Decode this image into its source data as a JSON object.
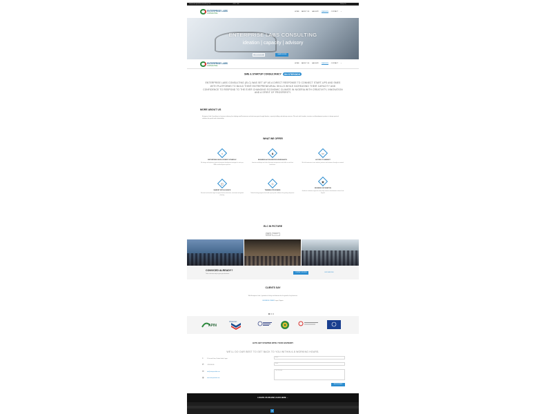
{
  "topbar": {
    "left": "info@enterpriselabsconsulting.com",
    "phone": "+234 · 000",
    "right": "Follow Us"
  },
  "logo": {
    "line1": "ENTERPRISE LABS",
    "line2": "CONSULTING"
  },
  "nav": {
    "items": [
      "HOME",
      "ABOUT US",
      "GALLERY",
      "CAREERS",
      "CONTACT"
    ],
    "active_index": 3,
    "search_icon": "search-icon"
  },
  "hero": {
    "title": "ENTERPRISE LABS CONSULTING",
    "tagline": "ideation | capacity | advisory",
    "btn_primary": "ABOUT US",
    "btn_secondary": "LEARN MORE"
  },
  "intro": {
    "title": "SME & STARTUP CONSULTANCY",
    "pill": "ON STEROIDS",
    "quote": "ENTERPRISE LABS CONSULTING (ELC) WAS SET UP AS A DIRECT RESPONSE TO CONNECT START-UPS AND SMES WITH PLATFORMS TO BUILD THEIR ENTREPRENEURIAL SKILLS WHILE INCREASING THEIR CAPACITY AND CONFIDENCE TO RESPOND TO THE EVER CHANGING ECONOMIC CLIMATE IN NIGERIA WITH CREATIVITY, INNOVATION AND A SPIRIT OF PROSPERITY."
  },
  "more_about": {
    "title": "MORE ABOUT US",
    "text": "Enterprise Labs Consulting is a business advisory firm helping small businesses and start-ups grow through ideation, capacity building and advisory services. We work with founders, investors and development partners to design practical solutions for growth and sustainability."
  },
  "services": {
    "title": "WHAT WE OFFER",
    "items": [
      {
        "icon": "building-icon",
        "glyph": "⌂",
        "title": "ENTERPRISE DEVELOPMENT STRATEGY",
        "desc": "We design and implement practical enterprise development strategies for start-ups, SMEs and development partners."
      },
      {
        "icon": "people-icon",
        "glyph": "♟",
        "title": "BUSINESS ACCELERATION WORKSHOPS",
        "desc": "Intensive workshops and clinics that equip entrepreneurs with skills to scale their businesses."
      },
      {
        "icon": "market-icon",
        "glyph": "▭",
        "title": "ACCESS TO MARKET",
        "desc": "We link businesses to new markets, partners and customers through our network."
      },
      {
        "icon": "chart-icon",
        "glyph": "◫",
        "title": "MARKET INTELLIGENCE",
        "desc": "Research and market insight to support business decisions, investment and growth planning."
      },
      {
        "icon": "training-icon",
        "glyph": "◇",
        "title": "TRAINING PROGRAMS",
        "desc": "Tailored training programs that build capacity and confidence for growing enterprises."
      },
      {
        "icon": "briefcase-icon",
        "glyph": "▣",
        "title": "BUSINESS INCUBATION",
        "desc": "Hands-on incubation support for early stage ventures from ideation to launch and beyond."
      }
    ]
  },
  "gallery": {
    "title": "ELC IN PICTURE",
    "filters": [
      "ALL",
      "EVENTS"
    ],
    "active_filter": 0
  },
  "convinced": {
    "title": "CONVICED ALREADY?",
    "subtitle": "Take a decisive step to grow your business.",
    "btn_primary": "CONTACT US NOW",
    "btn_secondary": "OUR SERVICES"
  },
  "clients_say": {
    "title": "CLIENTS SAY",
    "quote": "With Enterprise Labs, I gained real clarity and direction for the growth of my business.",
    "author": "BUSINESS OWNER",
    "author_meta": "Lagos, Nigeria"
  },
  "clients": [
    "APIN",
    "Chevron",
    "National Bureau",
    "Crest",
    "ELC Partner",
    "Emblem"
  ],
  "contact": {
    "title": "LETS GET STARTED WITH YOUR ADVISORY",
    "subtitle": "WE'LL DO OUR BEST TO GET BACK TO YOU WITHIN 6-8 WORKING HOURS.",
    "address": "5 Crescent Drive, Victoria Island, Lagos",
    "phone": "+234 000 000",
    "email": "info@enterpriselabs.com",
    "web": "www.enterpriselabs.com",
    "form": {
      "name": "Name",
      "email": "Email",
      "message": "Your Message",
      "submit": "SEND MESSAGE"
    }
  },
  "map_bar": "LOCATE US ON MAP, CLICK HERE →",
  "colors": {
    "accent": "#2b8ccf",
    "dark": "#111111",
    "brand_green": "#2e8b3e",
    "brand_red": "#d9302c"
  }
}
